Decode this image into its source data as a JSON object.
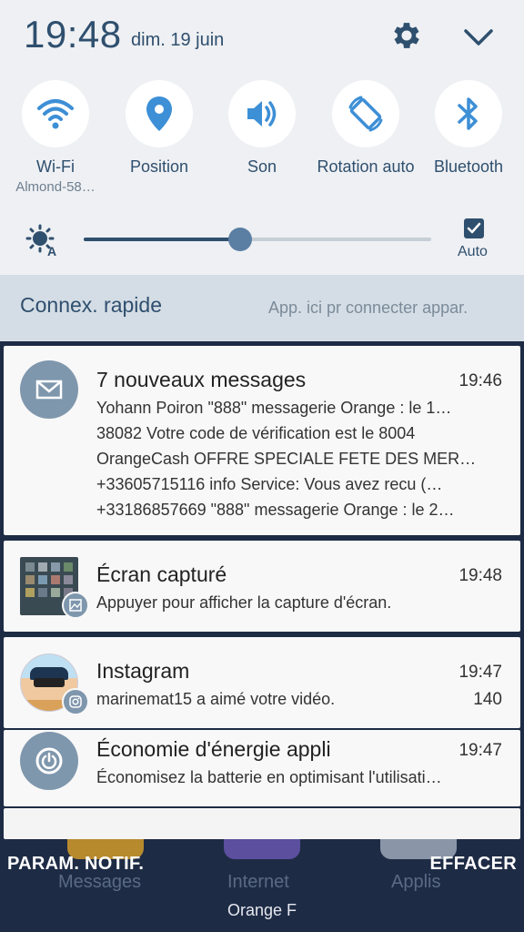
{
  "status": {
    "time": "19:48",
    "date": "dim. 19 juin"
  },
  "quick_tiles": [
    {
      "label": "Wi-Fi",
      "sub": "Almond-58…",
      "icon": "wifi-icon"
    },
    {
      "label": "Position",
      "sub": "",
      "icon": "location-icon"
    },
    {
      "label": "Son",
      "sub": "",
      "icon": "sound-icon"
    },
    {
      "label": "Rotation auto",
      "sub": "",
      "icon": "rotation-icon"
    },
    {
      "label": "Bluetooth",
      "sub": "",
      "icon": "bluetooth-icon"
    }
  ],
  "brightness": {
    "level": 0.45,
    "auto_label": "Auto",
    "auto_checked": true
  },
  "connex": {
    "title": "Connex. rapide",
    "hint": "App. ici pr connecter appar."
  },
  "notifications": {
    "messages": {
      "title": "7 nouveaux messages",
      "time": "19:46",
      "lines": [
        "Yohann Poiron  \"888\" messagerie Orange : le 1…",
        "38082  Votre code de vérification est le 8004",
        "OrangeCash  OFFRE SPECIALE FETE DES MER…",
        "+33605715116  info Service: Vous avez recu (…",
        "+33186857669  \"888\" messagerie Orange : le 2…"
      ]
    },
    "screenshot": {
      "title": "Écran capturé",
      "time": "19:48",
      "text": "Appuyer pour afficher la capture d'écran."
    },
    "instagram": {
      "title": "Instagram",
      "time": "19:47",
      "text": "marinemat15 a aimé votre vidéo.",
      "count": "140"
    },
    "energy": {
      "title": "Économie d'énergie appli",
      "time": "19:47",
      "text": "Économisez la batterie en optimisant l'utilisati…"
    }
  },
  "footer": {
    "left_button": "PARAM. NOTIF.",
    "right_button": "EFFACER",
    "carrier": "Orange F"
  },
  "dock": [
    "Messages",
    "Internet",
    "Applis"
  ],
  "colors": {
    "accent": "#2f4f6e",
    "tile_icon": "#3d8fd6",
    "panel_bg": "#eef0f3",
    "background": "#1e2b45"
  }
}
